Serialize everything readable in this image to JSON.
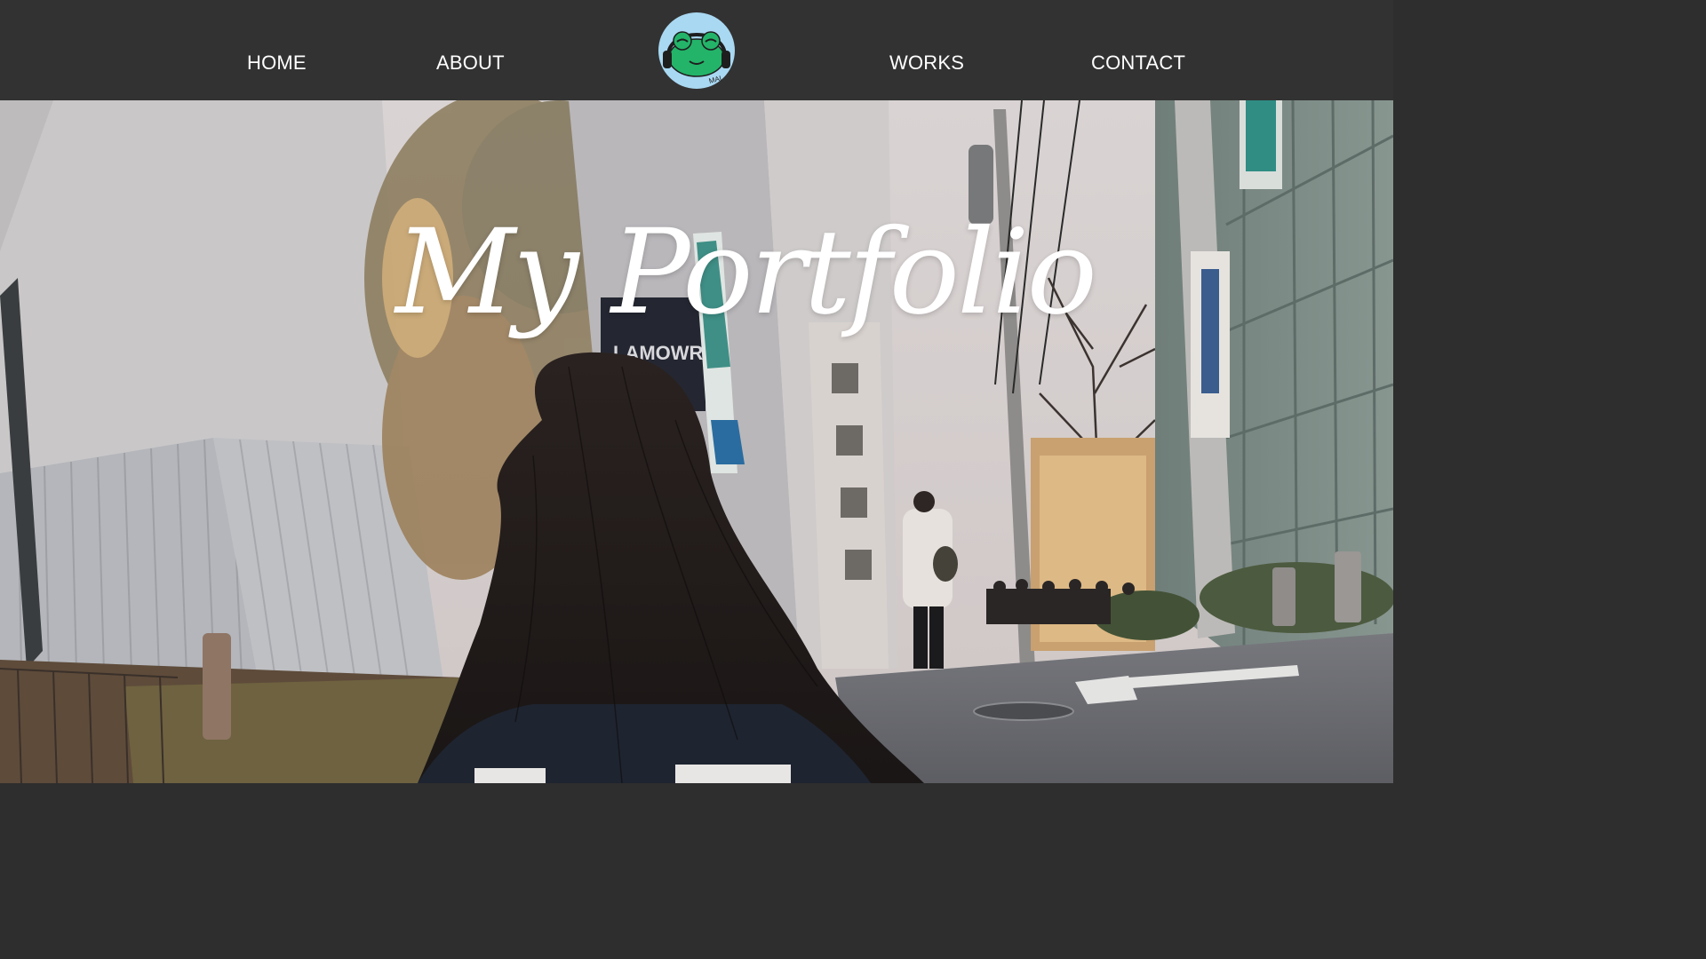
{
  "nav": {
    "items": [
      {
        "label": "HOME"
      },
      {
        "label": "ABOUT"
      },
      {
        "label": "WORKS"
      },
      {
        "label": "CONTACT"
      }
    ],
    "logo": {
      "icon": "frog-headphones-logo-icon",
      "text": "MAI"
    }
  },
  "hero": {
    "title": "My Portfolio",
    "background": "street-photo-woman-walking"
  },
  "colors": {
    "header_bg": "#323232",
    "nav_text": "#ffffff",
    "logo_bg": "#a9d8f2",
    "logo_frog": "#23b469"
  }
}
